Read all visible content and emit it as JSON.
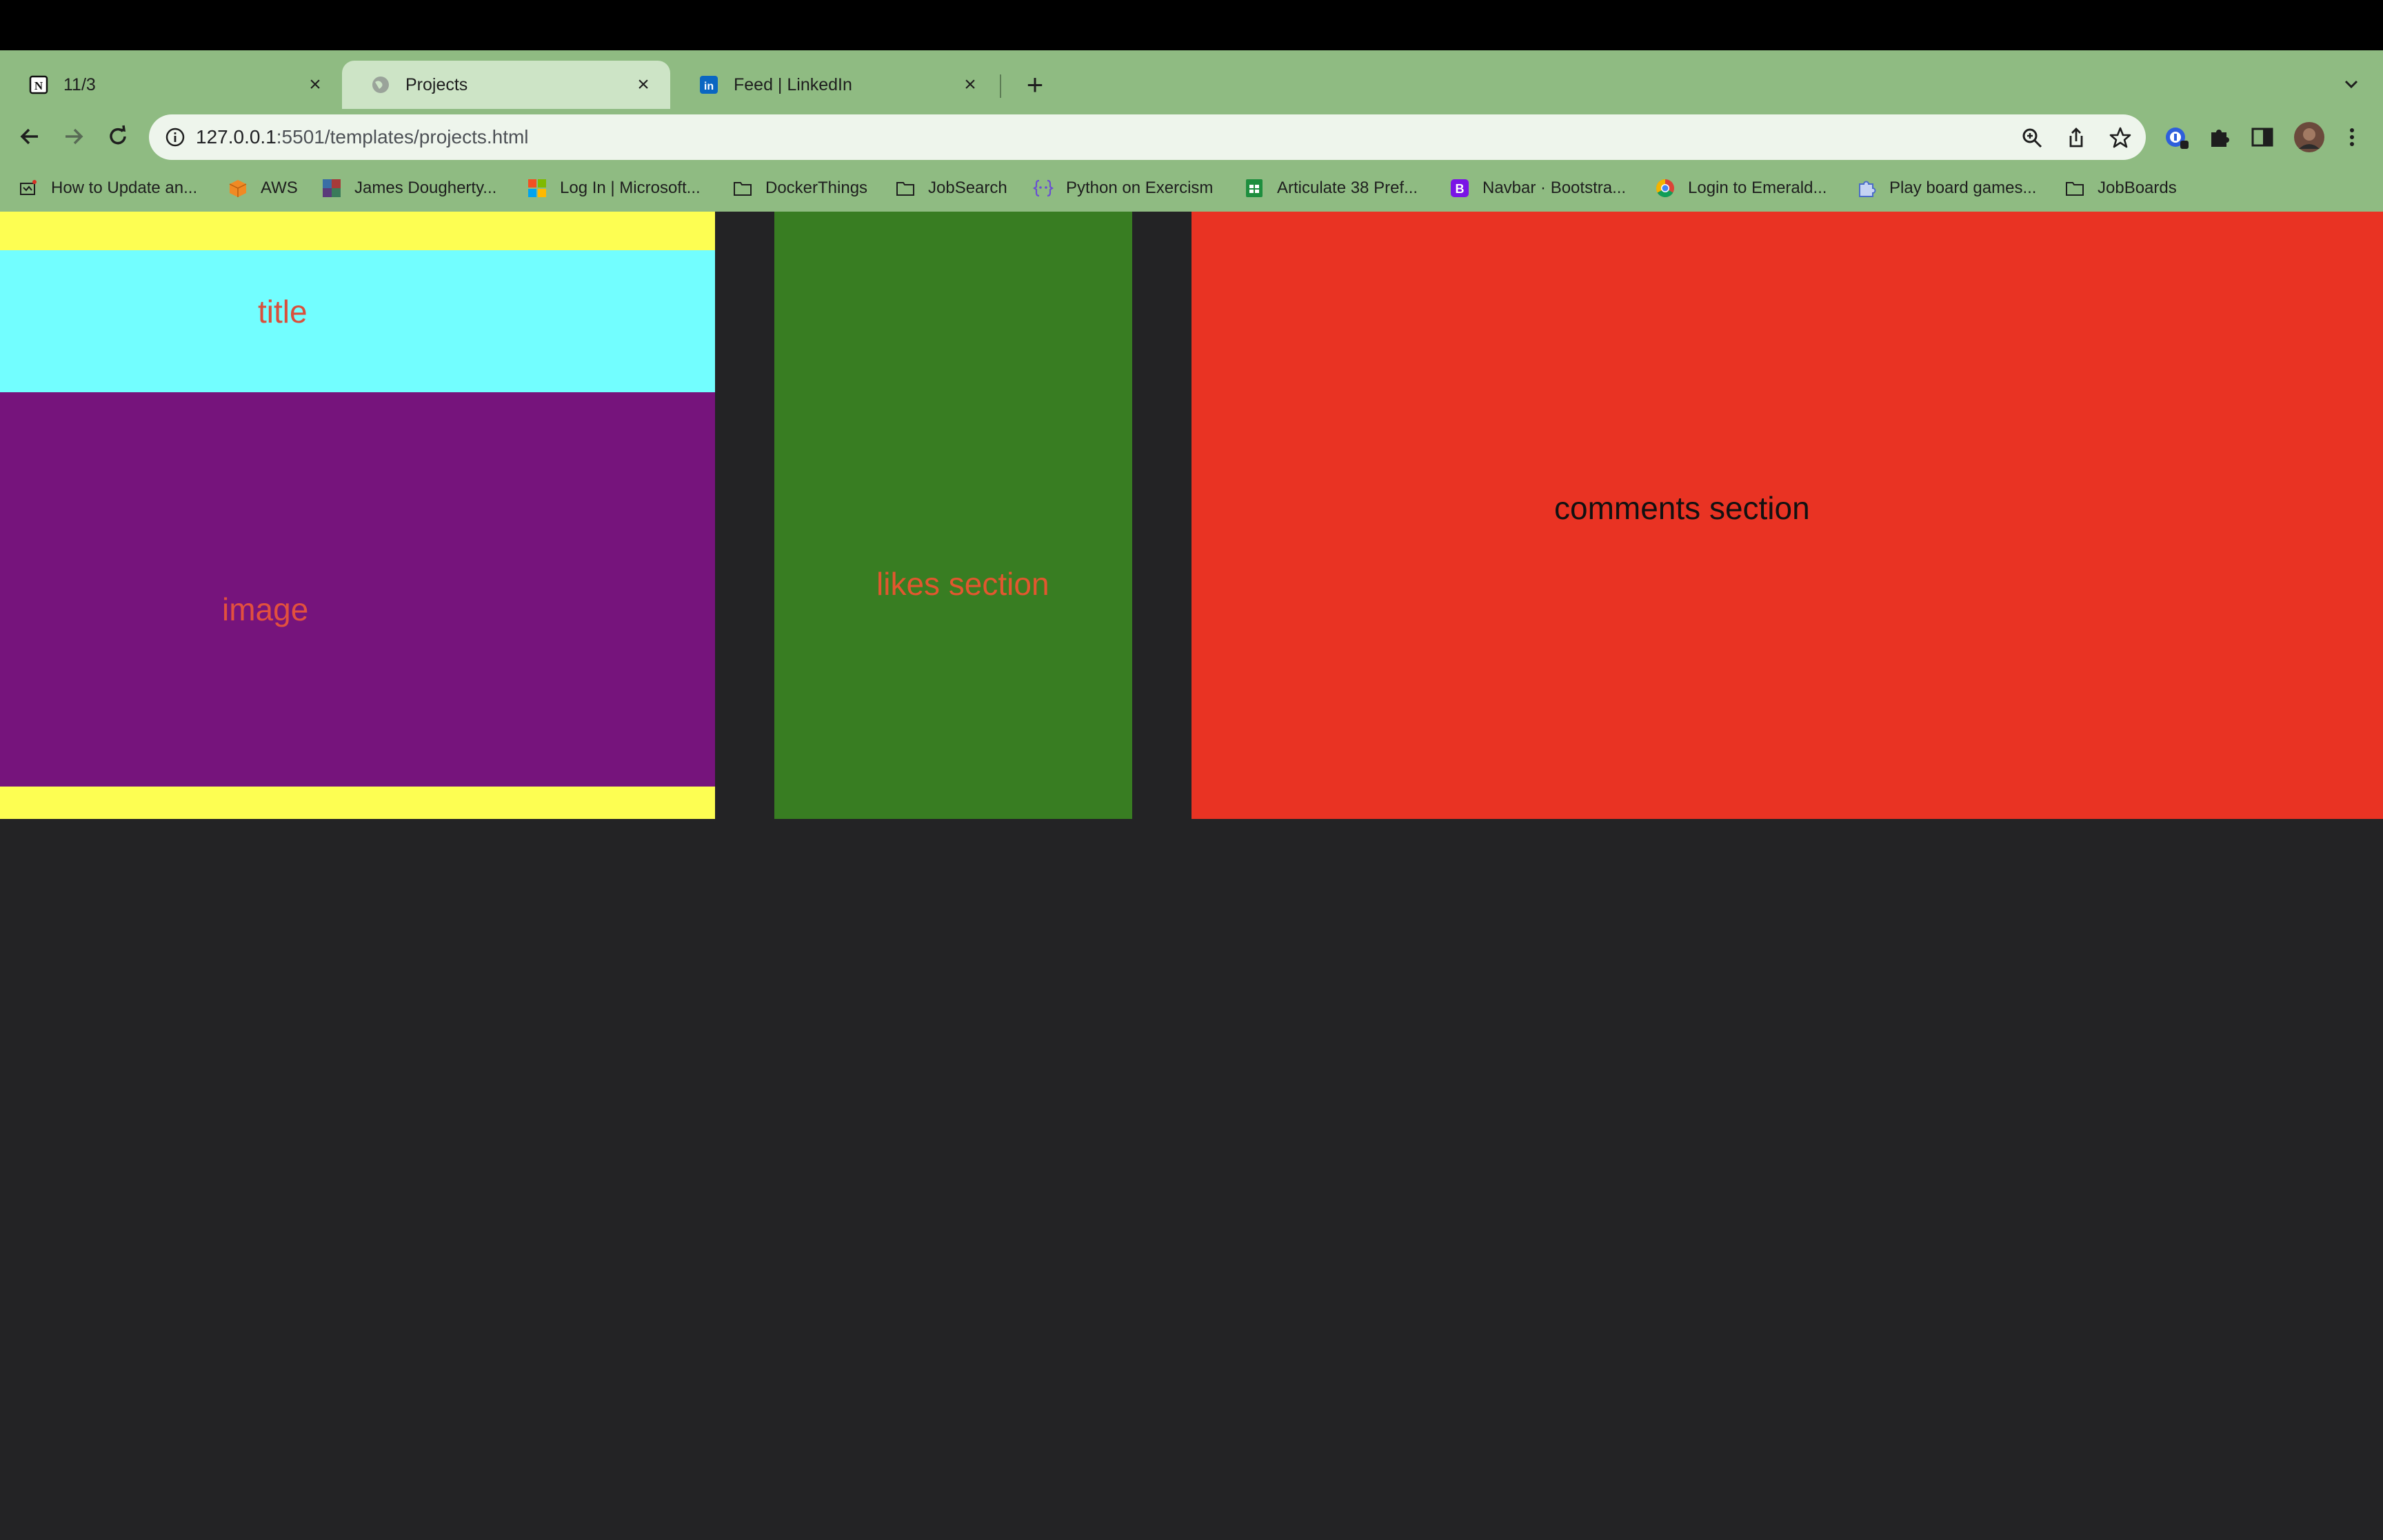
{
  "browser": {
    "tabs": [
      {
        "label": "11/3",
        "icon": "notion-icon",
        "active": false
      },
      {
        "label": "Projects",
        "icon": "globe-icon",
        "active": true
      },
      {
        "label": "Feed | LinkedIn",
        "icon": "linkedin-icon",
        "active": false
      }
    ],
    "close_glyph": "×",
    "new_tab_glyph": "+",
    "url": {
      "host": "127.0.0.1",
      "path": ":5501/templates/projects.html"
    },
    "bookmarks": [
      {
        "label": "How to Update an...",
        "icon": "bookmark-page-icon"
      },
      {
        "label": "AWS",
        "icon": "aws-cube-icon"
      },
      {
        "label": "James Dougherty...",
        "icon": "bookmark-image-icon"
      },
      {
        "label": "Log In | Microsoft...",
        "icon": "microsoft-icon"
      },
      {
        "label": "DockerThings",
        "icon": "folder-icon"
      },
      {
        "label": "JobSearch",
        "icon": "folder-icon"
      },
      {
        "label": "Python on Exercism",
        "icon": "exercism-icon"
      },
      {
        "label": "Articulate 38 Pref...",
        "icon": "sheets-icon"
      },
      {
        "label": "Navbar · Bootstra...",
        "icon": "bootstrap-icon"
      },
      {
        "label": "Login to Emerald...",
        "icon": "chrome-icon"
      },
      {
        "label": "Play board games...",
        "icon": "puzzle-piece-icon"
      },
      {
        "label": "JobBoards",
        "icon": "folder-icon"
      }
    ]
  },
  "page": {
    "title_label": "title",
    "image_label": "image",
    "likes_label": "likes section",
    "comments_label": "comments section"
  },
  "colors": {
    "chrome": "#8fbb82",
    "active_tab": "#cde4c6",
    "page_background": "#232325",
    "left_column": "#fdfe52",
    "title_box": "#72feff",
    "image_box": "#76147c",
    "likes_box": "#387d22",
    "comments_box": "#e93323"
  }
}
